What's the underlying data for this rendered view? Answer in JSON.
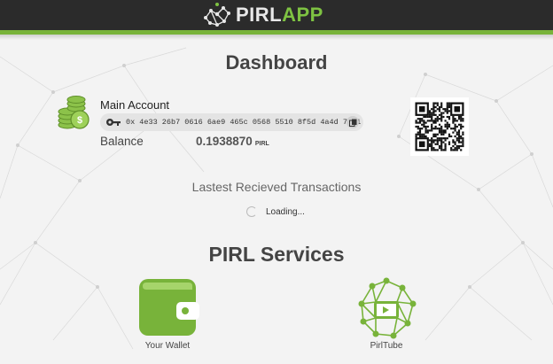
{
  "header": {
    "logo_part1": "PIRL",
    "logo_part2": "APP",
    "accent_color": "#78b33a"
  },
  "dashboard": {
    "title": "Dashboard"
  },
  "account": {
    "name": "Main Account",
    "address": "0x 4e33 26b7 0616 6ae9 465c 0568 5510 8f5d 4a4d 7ef1",
    "balance_label": "Balance",
    "balance_value": "0.1938870",
    "balance_unit": "PIRL",
    "icons": {
      "coin": "coin-stack-icon",
      "key": "key-icon",
      "copy": "copy-icon",
      "qr": "qr-code-icon"
    }
  },
  "transactions": {
    "title": "Lastest Recieved Transactions",
    "loading_text": "Loading..."
  },
  "services": {
    "title": "PIRL Services",
    "items": [
      {
        "label": "Your Wallet",
        "icon": "wallet-icon",
        "color": "#78b33a"
      },
      {
        "label": "PirlTube",
        "icon": "pirltube-icon",
        "color": "#78b33a"
      }
    ]
  }
}
